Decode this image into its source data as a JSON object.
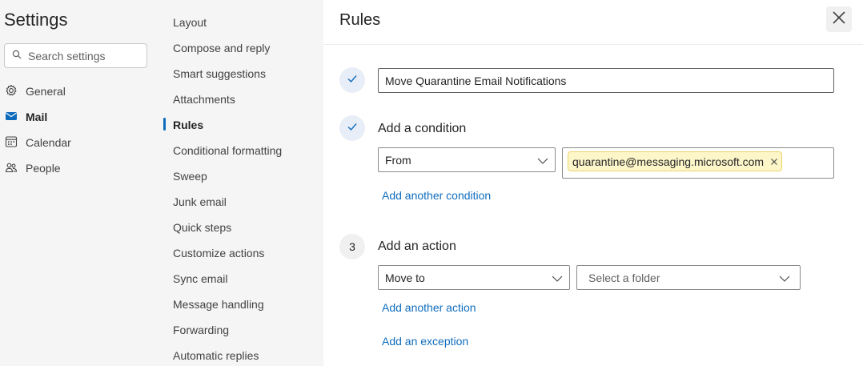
{
  "left_nav": {
    "title": "Settings",
    "search_placeholder": "Search settings",
    "items": [
      {
        "label": "General",
        "icon": "gear-icon"
      },
      {
        "label": "Mail",
        "icon": "mail-icon",
        "active": true
      },
      {
        "label": "Calendar",
        "icon": "calendar-icon"
      },
      {
        "label": "People",
        "icon": "people-icon"
      }
    ]
  },
  "sub_nav": {
    "items": [
      "Layout",
      "Compose and reply",
      "Smart suggestions",
      "Attachments",
      "Rules",
      "Conditional formatting",
      "Sweep",
      "Junk email",
      "Quick steps",
      "Customize actions",
      "Sync email",
      "Message handling",
      "Forwarding",
      "Automatic replies"
    ],
    "active": "Rules"
  },
  "rule_editor": {
    "title": "Rules",
    "rule_name": "Move Quarantine Email Notifications",
    "condition": {
      "heading": "Add a condition",
      "field": "From",
      "values": [
        "quarantine@messaging.microsoft.com"
      ],
      "add_link": "Add another condition"
    },
    "action": {
      "step_number": "3",
      "heading": "Add an action",
      "type": "Move to",
      "folder_placeholder": "Select a folder",
      "add_link": "Add another action"
    },
    "exception_link": "Add an exception"
  },
  "colors": {
    "accent": "#0f6cbd",
    "tag_background": "#fdf6c9",
    "step_done_background": "#e8eef7"
  }
}
